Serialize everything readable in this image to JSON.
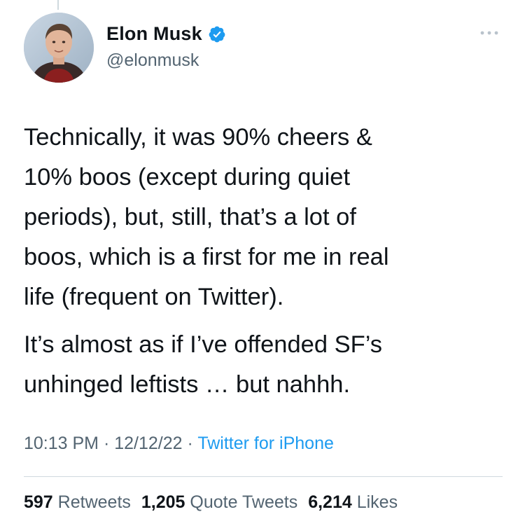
{
  "author": {
    "display_name": "Elon Musk",
    "handle": "@elonmusk",
    "verified": true,
    "avatar_icon": "profile-photo"
  },
  "tweet": {
    "paragraph_1": "Technically, it was 90% cheers &\n10% boos (except during quiet\nperiods), but, still, that’s a lot of\nboos, which is a first for me in real\nlife (frequent on Twitter).",
    "paragraph_2": "It’s almost as if I’ve offended SF’s\nunhinged leftists … but nahhh."
  },
  "meta": {
    "time": "10:13 PM",
    "separator": "·",
    "date": "12/12/22",
    "source": "Twitter for iPhone"
  },
  "stats": {
    "retweets_count": "597",
    "retweets_label": "Retweets",
    "quotes_count": "1,205",
    "quotes_label": "Quote Tweets",
    "likes_count": "6,214",
    "likes_label": "Likes"
  },
  "colors": {
    "accent": "#1d9bf0",
    "text": "#0f1419",
    "secondary": "#536471",
    "divider": "#cfd9de"
  }
}
